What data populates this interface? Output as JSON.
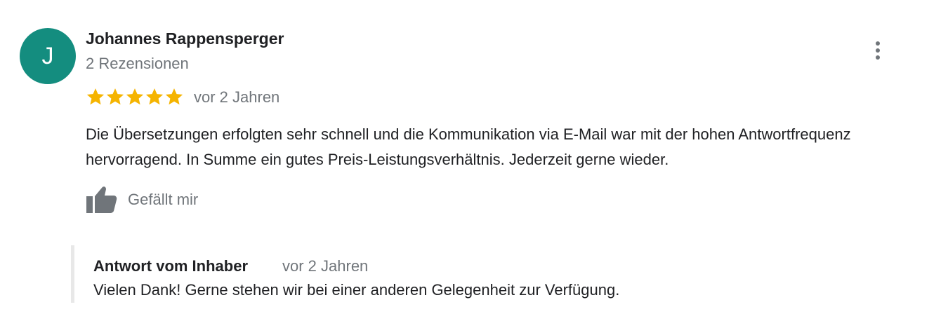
{
  "review": {
    "author": {
      "initial": "J",
      "name": "Johannes Rappensperger",
      "review_count": "2 Rezensionen",
      "avatar_color": "#148d7f"
    },
    "rating": 5,
    "rating_max": 5,
    "star_color": "#f5b400",
    "date": "vor 2 Jahren",
    "text": "Die Übersetzungen erfolgten sehr schnell und die Kommunikation via E-Mail war mit der hohen Antwortfrequenz hervorragend. In Summe ein gutes Preis-Leistungsverhältnis. Jederzeit gerne wieder.",
    "like_label": "Gefällt mir",
    "icons": {
      "menu": "more-vert-icon",
      "like": "thumb-up-icon",
      "star": "star-icon"
    }
  },
  "owner_reply": {
    "label": "Antwort vom Inhaber",
    "date": "vor 2 Jahren",
    "text": "Vielen Dank! Gerne stehen wir bei einer anderen Gelegenheit zur Verfügung."
  }
}
